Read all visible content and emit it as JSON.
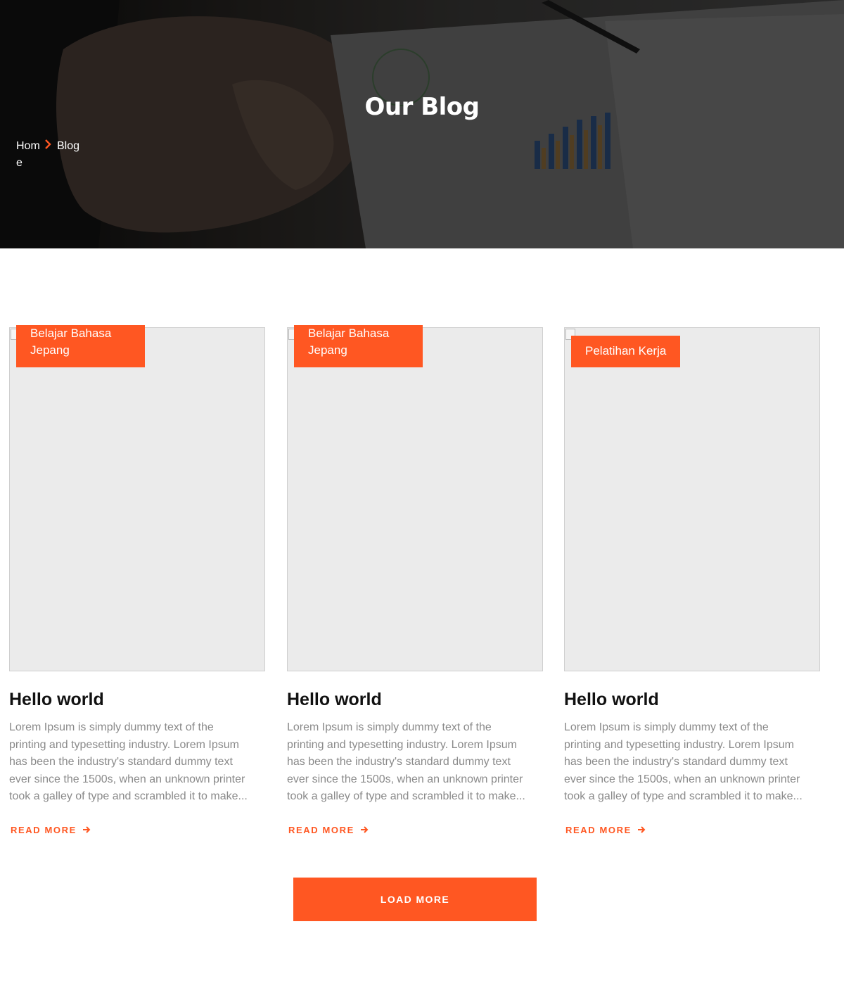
{
  "hero": {
    "title": "Our Blog",
    "breadcrumb": {
      "home": "Home",
      "current": "Blog"
    }
  },
  "posts": [
    {
      "category": "Belajar Bahasa Jepang",
      "title": "Hello world",
      "excerpt": "Lorem Ipsum is simply dummy text of the printing and typesetting industry. Lorem Ipsum has been the industry's standard dummy text ever since the 1500s, when an unknown printer took a galley of type and scrambled it to make...",
      "read_more": "READ MORE"
    },
    {
      "category": "Belajar Bahasa Jepang",
      "title": "Hello world",
      "excerpt": "Lorem Ipsum is simply dummy text of the printing and typesetting industry. Lorem Ipsum has been the industry's standard dummy text ever since the 1500s, when an unknown printer took a galley of type and scrambled it to make...",
      "read_more": "READ MORE"
    },
    {
      "category": "Pelatihan Kerja",
      "title": "Hello world",
      "excerpt": "Lorem Ipsum is simply dummy text of the printing and typesetting industry. Lorem Ipsum has been the industry's standard dummy text ever since the 1500s, when an unknown printer took a galley of type and scrambled it to make...",
      "read_more": "READ MORE"
    }
  ],
  "load_more": "LOAD MORE",
  "colors": {
    "accent": "#ff5722",
    "text_muted": "#8a8a8a",
    "image_placeholder": "#ebebeb"
  },
  "icons": {
    "breadcrumb_separator": "chevron-right-icon",
    "read_more": "arrow-right-icon"
  }
}
